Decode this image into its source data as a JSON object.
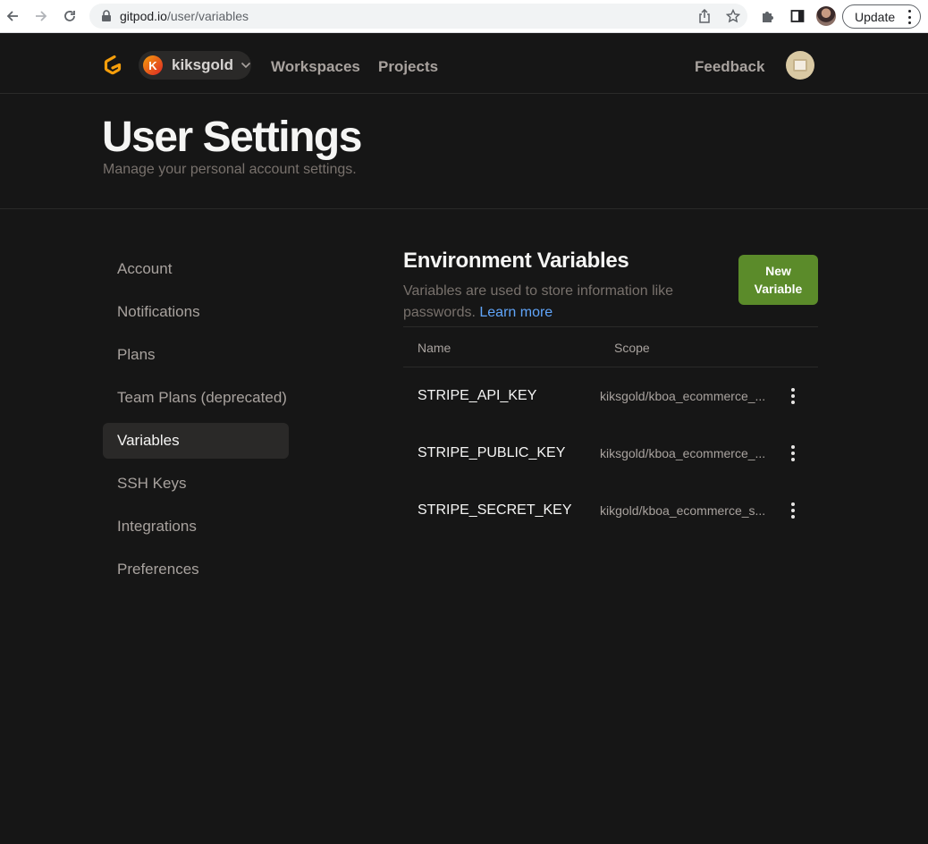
{
  "browser": {
    "url_host": "gitpod.io",
    "url_path": "/user/variables",
    "update_label": "Update"
  },
  "header": {
    "org_initial": "K",
    "org_name": "kiksgold",
    "nav": {
      "workspaces": "Workspaces",
      "projects": "Projects",
      "feedback": "Feedback"
    }
  },
  "page": {
    "title": "User Settings",
    "subtitle": "Manage your personal account settings."
  },
  "sidebar": {
    "items": [
      {
        "label": "Account"
      },
      {
        "label": "Notifications"
      },
      {
        "label": "Plans"
      },
      {
        "label": "Team Plans (deprecated)"
      },
      {
        "label": "Variables"
      },
      {
        "label": "SSH Keys"
      },
      {
        "label": "Integrations"
      },
      {
        "label": "Preferences"
      }
    ]
  },
  "main": {
    "title": "Environment Variables",
    "description": "Variables are used to store information like passwords.",
    "learn_more": "Learn more",
    "new_button_line1": "New",
    "new_button_line2": "Variable",
    "table": {
      "headers": {
        "name": "Name",
        "scope": "Scope"
      },
      "rows": [
        {
          "name": "STRIPE_API_KEY",
          "scope": "kiksgold/kboa_ecommerce_..."
        },
        {
          "name": "STRIPE_PUBLIC_KEY",
          "scope": "kiksgold/kboa_ecommerce_..."
        },
        {
          "name": "STRIPE_SECRET_KEY",
          "scope": "kikgold/kboa_ecommerce_s..."
        }
      ]
    }
  },
  "colors": {
    "background": "#161616",
    "primary_button": "#5b8b2a",
    "link": "#60a5fa",
    "logo": "#f59e0b"
  },
  "icons": {
    "back": "arrow-left-icon",
    "forward": "arrow-right-icon",
    "reload": "reload-icon",
    "lock": "lock-icon",
    "share": "share-icon",
    "star": "star-icon",
    "extensions": "puzzle-icon",
    "sidepanel": "sidepanel-icon",
    "row_menu": "kebab-icon",
    "chevron": "chevron-down-icon"
  }
}
